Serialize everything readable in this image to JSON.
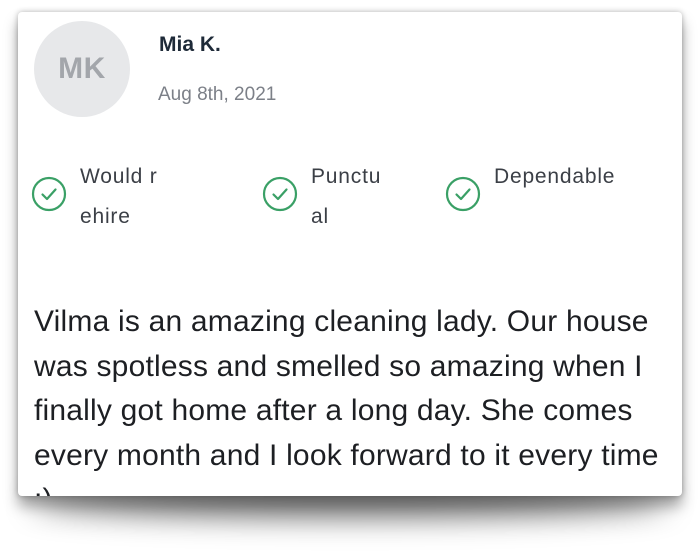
{
  "review": {
    "avatar_initials": "MK",
    "reviewer_name": "Mia K.",
    "date": "Aug 8th, 2021",
    "badges": [
      {
        "label": "Would rehire",
        "icon": "check-circle-icon"
      },
      {
        "label": "Punctual",
        "icon": "check-circle-icon"
      },
      {
        "label": "Dependable",
        "icon": "check-circle-icon"
      }
    ],
    "text": "Vilma is an amazing cleaning lady. Our house was spotless and smelled so amazing when I finally got home after a long day. She comes every month and I look forward to it every time :)"
  },
  "colors": {
    "accent": "#3aa066",
    "avatar_bg": "#e7e8ea",
    "avatar_text": "#a3a6ab",
    "name_text": "#1e2a38",
    "date_text": "#7c8088",
    "body_text": "#1d1f23"
  }
}
